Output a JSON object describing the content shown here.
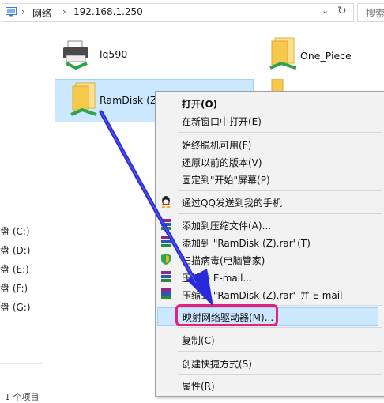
{
  "address": {
    "crumbs": [
      "网络",
      "192.168.1.250"
    ],
    "search_placeholder": "搜索"
  },
  "nav": {
    "drives": [
      "盘 (C:)",
      "盘 (D:)",
      "盘 (E:)",
      "盘 (F:)",
      "盘 (G:)"
    ],
    "status": "1 个项目"
  },
  "items": {
    "printer": "lq590",
    "one_piece": "One_Piece",
    "ramdisk": "RamDisk (Z)"
  },
  "menu": {
    "open": "打开(O)",
    "open_new_window": "在新窗口中打开(E)",
    "always_offline": "始终脱机可用(F)",
    "restore_previous": "还原以前的版本(V)",
    "pin_start": "固定到\"开始\"屏幕(P)",
    "qq_send": "通过QQ发送到我的手机",
    "add_archive": "添加到压缩文件(A)...",
    "add_rar": "添加到 \"RamDisk (Z).rar\"(T)",
    "virus_scan": "扫描病毒(电脑管家)",
    "compress_email": "压缩并 E-mail...",
    "compress_rar_email": "压缩到 \"RamDisk (Z).rar\" 并 E-mail",
    "map_drive": "映射网络驱动器(M)...",
    "copy": "复制(C)",
    "create_shortcut": "创建快捷方式(S)",
    "properties": "属性(R)"
  },
  "colors": {
    "highlight_box": "#e8207a",
    "arrow": "#2a2ad8",
    "selection_bg": "#cce8ff"
  }
}
